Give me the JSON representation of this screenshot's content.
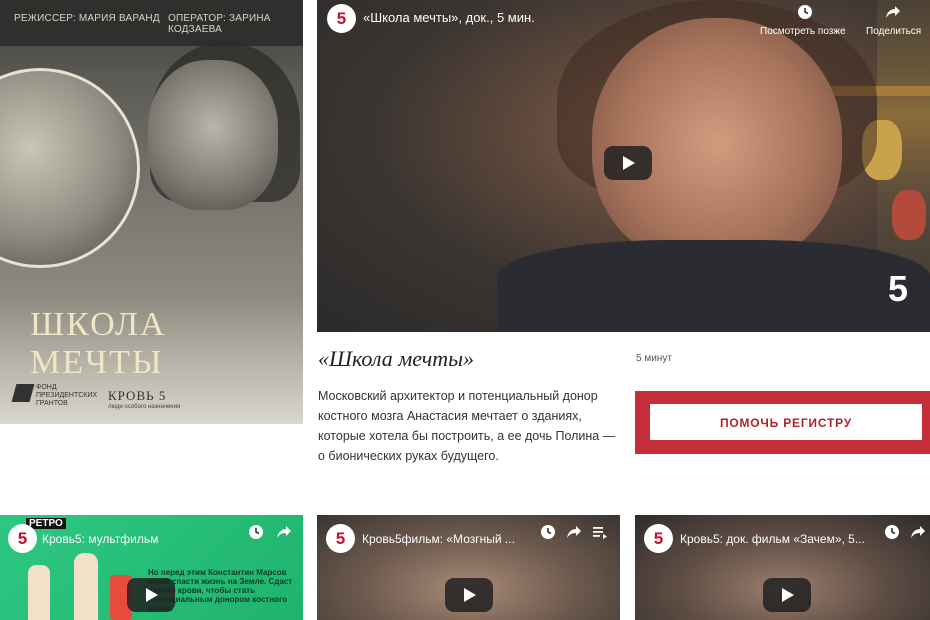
{
  "poster": {
    "director": "РЕЖИССЕР: МАРИЯ ВАРАНД",
    "operator": "ОПЕРАТОР: ЗАРИНА КОДЗАЕВА",
    "title": "ШКОЛА МЕЧТЫ",
    "fund": "ФОНД ПРЕЗИДЕНТСКИХ ГРАНТОВ",
    "brand": "КРОВЬ 5",
    "brand_sub": "люди особого назначения"
  },
  "main_video": {
    "channel_logo": "5",
    "title": "«Школа мечты», док., 5 мин.",
    "watch_later": "Посмотреть позже",
    "share": "Поделиться",
    "watermark": "5"
  },
  "film": {
    "title": "«Школа мечты»",
    "duration": "5 минут",
    "description": "Московский архитектор и потенциальный донор костного мозга Анастасия мечтает о зданиях, которые хотела бы построить, а ее дочь Полина — о бионических руках будущего."
  },
  "cta": {
    "label": "ПОМОЧЬ РЕГИСТРУ"
  },
  "videos": [
    {
      "title": "Кровь5: мультфильм",
      "badge": "РЕТРО",
      "overlay": "Но перед этим Константин Марсов хочет спасти жизнь на Земле. Сдаст анализ крови, чтобы стать потенциальным донором костного мозга."
    },
    {
      "title": "Кровь5фильм: «Мозгный ..."
    },
    {
      "title": "Кровь5: док. фильм «Зачем», 5..."
    }
  ],
  "colors": {
    "accent": "#c62f3a",
    "white": "#ffffff"
  }
}
